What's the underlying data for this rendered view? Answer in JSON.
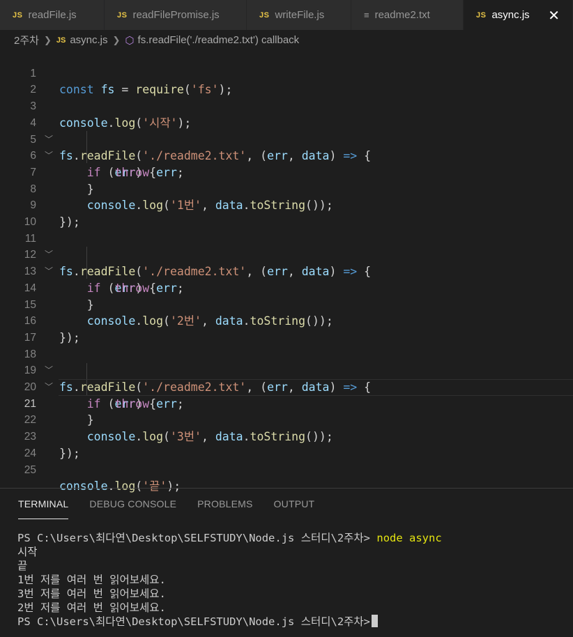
{
  "tabs": [
    {
      "icon": "JS",
      "label": "readFile.js"
    },
    {
      "icon": "JS",
      "label": "readFilePromise.js"
    },
    {
      "icon": "JS",
      "label": "writeFile.js"
    },
    {
      "icon": "text-file-icon",
      "label": "readme2.txt"
    },
    {
      "icon": "JS",
      "label": "async.js",
      "close": "✕"
    }
  ],
  "breadcrumb": {
    "folder": "2주차",
    "file_badge": "JS",
    "file": "async.js",
    "symbol": "fs.readFile('./readme2.txt') callback"
  },
  "editor": {
    "line_numbers": [
      "1",
      "2",
      "3",
      "4",
      "5",
      "6",
      "7",
      "8",
      "9",
      "10",
      "11",
      "12",
      "13",
      "14",
      "15",
      "16",
      "17",
      "18",
      "19",
      "20",
      "21",
      "22",
      "23",
      "24",
      "25"
    ],
    "current_line": "21"
  },
  "panel": {
    "tabs": [
      "TERMINAL",
      "DEBUG CONSOLE",
      "PROBLEMS",
      "OUTPUT"
    ],
    "active_tab": "TERMINAL"
  },
  "terminal": {
    "prompt": "PS C:\\Users\\최다연\\Desktop\\SELFSTUDY\\Node.js 스터디\\2주차>",
    "command": "node async",
    "output": [
      "시작",
      "끝",
      "1번 저를 여러 번 읽어보세요.",
      "3번 저를 여러 번 읽어보세요.",
      "2번 저를 여러 번 읽어보세요."
    ],
    "prompt2": "PS C:\\Users\\최다연\\Desktop\\SELFSTUDY\\Node.js 스터디\\2주차>"
  },
  "colors": {
    "background": "#1e1e1e",
    "keyword": "#569cd6",
    "string": "#ce9178",
    "function": "#dcdcaa",
    "variable": "#9cdcfe",
    "control": "#c586c0"
  }
}
